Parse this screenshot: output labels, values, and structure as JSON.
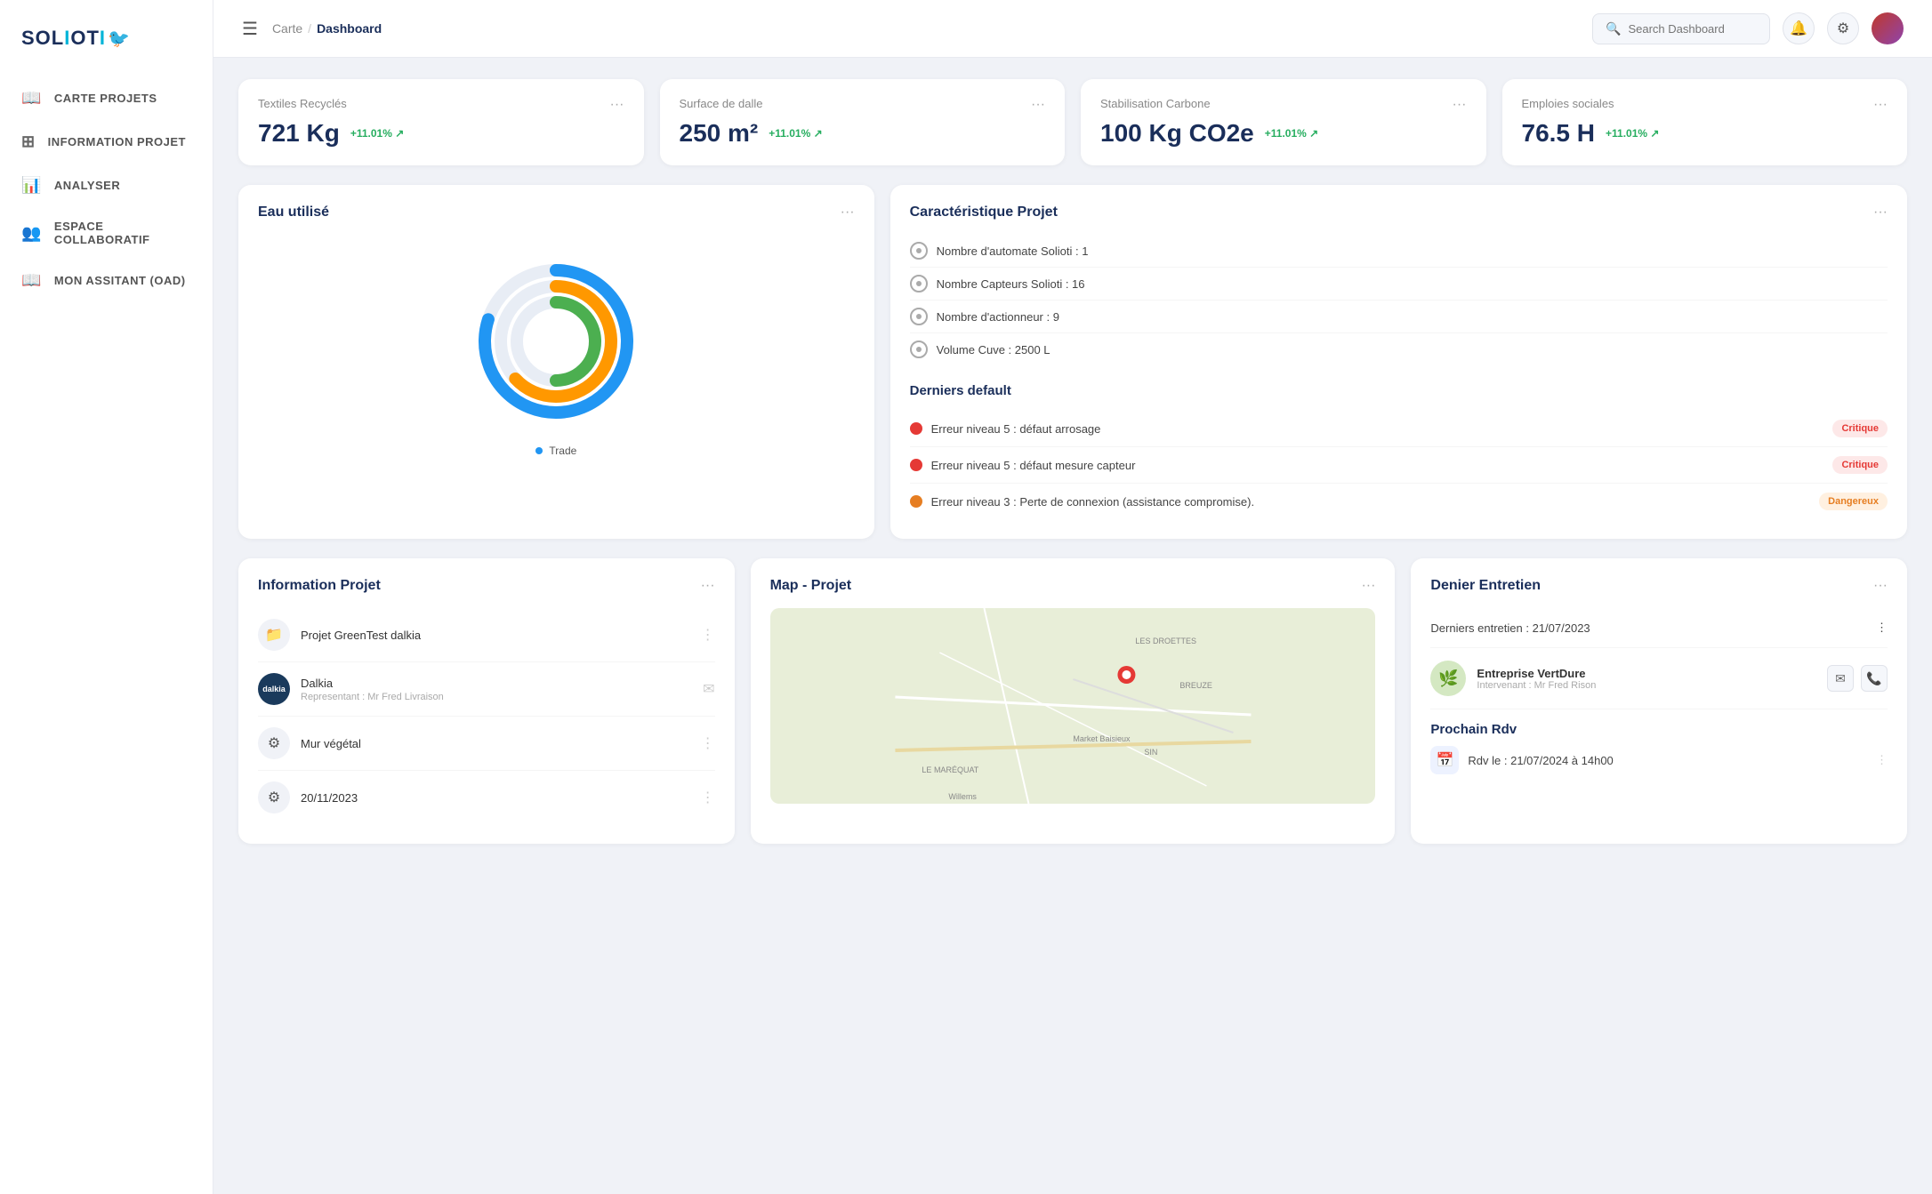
{
  "app": {
    "name": "SOLIOTI",
    "logo_bird": "🐦"
  },
  "sidebar": {
    "nav_items": [
      {
        "id": "carte-projets",
        "label": "CARTE PROJETS",
        "icon": "📖"
      },
      {
        "id": "information-projet",
        "label": "INFORMATION PROJET",
        "icon": "⊞"
      },
      {
        "id": "analyser",
        "label": "ANALYSER",
        "icon": "📊"
      },
      {
        "id": "espace-collaboratif",
        "label": "ESPACE COLLABORATIF",
        "icon": "👥"
      },
      {
        "id": "mon-assistant",
        "label": "MON ASSITANT (OAD)",
        "icon": "📖"
      }
    ]
  },
  "header": {
    "breadcrumb_parent": "Carte",
    "breadcrumb_sep": "/",
    "breadcrumb_current": "Dashboard",
    "search_placeholder": "Search Dashboard"
  },
  "stats": [
    {
      "title": "Textiles Recyclés",
      "value": "721 Kg",
      "trend": "+11.01% ↗"
    },
    {
      "title": "Surface de dalle",
      "value": "250 m²",
      "trend": "+11.01% ↗"
    },
    {
      "title": "Stabilisation Carbone",
      "value": "100 Kg CO2e",
      "trend": "+11.01% ↗"
    },
    {
      "title": "Emploies sociales",
      "value": "76.5 H",
      "trend": "+11.01% ↗"
    }
  ],
  "eau_utilise": {
    "title": "Eau utilisé",
    "legend_label": "Trade",
    "donut": {
      "rings": [
        {
          "color": "#2196F3",
          "percent": 80
        },
        {
          "color": "#FF9800",
          "percent": 65
        },
        {
          "color": "#4CAF50",
          "percent": 50
        }
      ]
    }
  },
  "caracteristique": {
    "title": "Caractéristique Projet",
    "items": [
      {
        "label": "Nombre d'automate Solioti : 1"
      },
      {
        "label": "Nombre Capteurs Solioti : 16"
      },
      {
        "label": "Nombre d'actionneur : 9"
      },
      {
        "label": "Volume Cuve :  2500 L"
      }
    ],
    "defaults_title": "Derniers default",
    "defaults": [
      {
        "text": "Erreur niveau 5 : défaut arrosage",
        "badge": "Critique",
        "badge_type": "critique",
        "color": "#e53935"
      },
      {
        "text": "Erreur niveau 5 : défaut mesure capteur",
        "badge": "Critique",
        "badge_type": "critique",
        "color": "#e53935"
      },
      {
        "text": "Erreur niveau 3 : Perte de connexion (assistance compromise).",
        "badge": "Dangereux",
        "badge_type": "dangereux",
        "color": "#e67e22"
      }
    ]
  },
  "info_projet": {
    "title": "Information Projet",
    "items": [
      {
        "icon": "📁",
        "name": "Projet GreenTest dalkia",
        "sub": null,
        "has_avatar": false
      },
      {
        "icon": null,
        "name": "Dalkia",
        "sub": "Representant : Mr Fred Livraison",
        "has_avatar": true,
        "avatar_text": "dalkia"
      },
      {
        "icon": "⚙",
        "name": "Mur végétal",
        "sub": null,
        "has_avatar": false
      },
      {
        "icon": "⚙",
        "name": "20/11/2023",
        "sub": null,
        "has_avatar": false
      }
    ]
  },
  "map": {
    "title": "Map - Projet",
    "places": [
      "LES DROETTES",
      "BREUZE",
      "Market Baisieux",
      "SIN",
      "LE MARÉQUAT",
      "Willems"
    ]
  },
  "entretien": {
    "title": "Denier Entretien",
    "last_date_label": "Derniers entretien : 21/07/2023",
    "person": {
      "name": "Entreprise VertDure",
      "role": "Intervenant : Mr Fred Rison"
    },
    "prochain_title": "Prochain Rdv",
    "rdv_label": "Rdv le : 21/07/2024 à 14h00"
  },
  "icons": {
    "more": "···",
    "search": "🔍",
    "bell": "🔔",
    "gear": "⚙",
    "email": "✉",
    "phone": "📞",
    "calendar": "📅"
  }
}
